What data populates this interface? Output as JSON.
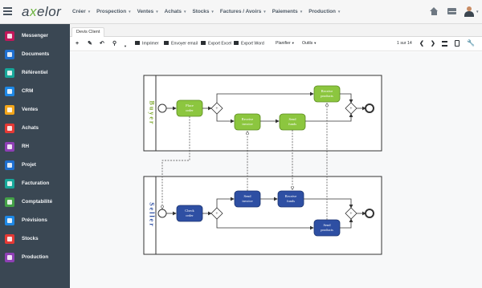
{
  "topbar": {
    "logo_prefix": "a",
    "logo_x": "x",
    "logo_suffix": "elor",
    "nav": [
      {
        "label": "Créer",
        "caret": "▼"
      },
      {
        "label": "Prospection",
        "caret": "▼"
      },
      {
        "label": "Ventes",
        "caret": "▼"
      },
      {
        "label": "Achats",
        "caret": "▼"
      },
      {
        "label": "Stocks",
        "caret": "▼"
      },
      {
        "label": "Factures / Avoirs",
        "caret": "▼"
      },
      {
        "label": "Paiements",
        "caret": "▼"
      },
      {
        "label": "Production",
        "caret": "▼"
      }
    ],
    "user_caret": "▼"
  },
  "sidebar": {
    "items": [
      {
        "label": "Messenger",
        "icon": "messenger-icon",
        "color": "#c2185b"
      },
      {
        "label": "Documents",
        "icon": "documents-icon",
        "color": "#1e6fd0"
      },
      {
        "label": "Référentiel",
        "icon": "referentiel-icon",
        "color": "#17a79a"
      },
      {
        "label": "CRM",
        "icon": "crm-icon",
        "color": "#1e88e5"
      },
      {
        "label": "Ventes",
        "icon": "ventes-icon",
        "color": "#f2a51a"
      },
      {
        "label": "Achats",
        "icon": "achats-icon",
        "color": "#e53935"
      },
      {
        "label": "RH",
        "icon": "rh-icon",
        "color": "#8e3fb5"
      },
      {
        "label": "Projet",
        "icon": "projet-icon",
        "color": "#1e6fd0"
      },
      {
        "label": "Facturation",
        "icon": "facturation-icon",
        "color": "#17a79a"
      },
      {
        "label": "Comptabilité",
        "icon": "comptabilite-icon",
        "color": "#43a047"
      },
      {
        "label": "Prévisions",
        "icon": "previsions-icon",
        "color": "#1e88e5"
      },
      {
        "label": "Stocks",
        "icon": "stocks-icon",
        "color": "#e53935"
      },
      {
        "label": "Production",
        "icon": "production-icon",
        "color": "#8e3fb5"
      }
    ]
  },
  "tab": {
    "label": "Devis Client"
  },
  "toolbar": {
    "add": "+",
    "edit": "✎",
    "undo": "↶",
    "attach": "⚲",
    "more_caret": "▼",
    "print": "Imprimer",
    "send_email": "Envoyer email",
    "export_excel": "Export Excel",
    "export_word": "Export Word",
    "plan": "Planifier",
    "tools": "Outils",
    "caret": "▼",
    "pager": "1 sur 14",
    "prev": "❮",
    "next": "❯"
  },
  "diagram": {
    "pool_buyer": "Buyer",
    "pool_seller": "Seller",
    "buyer_tasks": {
      "place_order": [
        "Place",
        "order"
      ],
      "receive_invoice": [
        "Receive",
        "invoice"
      ],
      "send_funds": [
        "Send",
        "funds"
      ],
      "receive_products": [
        "Receive",
        "products"
      ]
    },
    "seller_tasks": {
      "check_order": [
        "Check",
        "order"
      ],
      "send_invoice": [
        "Send",
        "invoice"
      ],
      "receive_funds": [
        "Receive",
        "funds"
      ],
      "send_products": [
        "Send",
        "products"
      ]
    },
    "buyer_color": "#8cc63f",
    "seller_color": "#2e4fa3"
  }
}
